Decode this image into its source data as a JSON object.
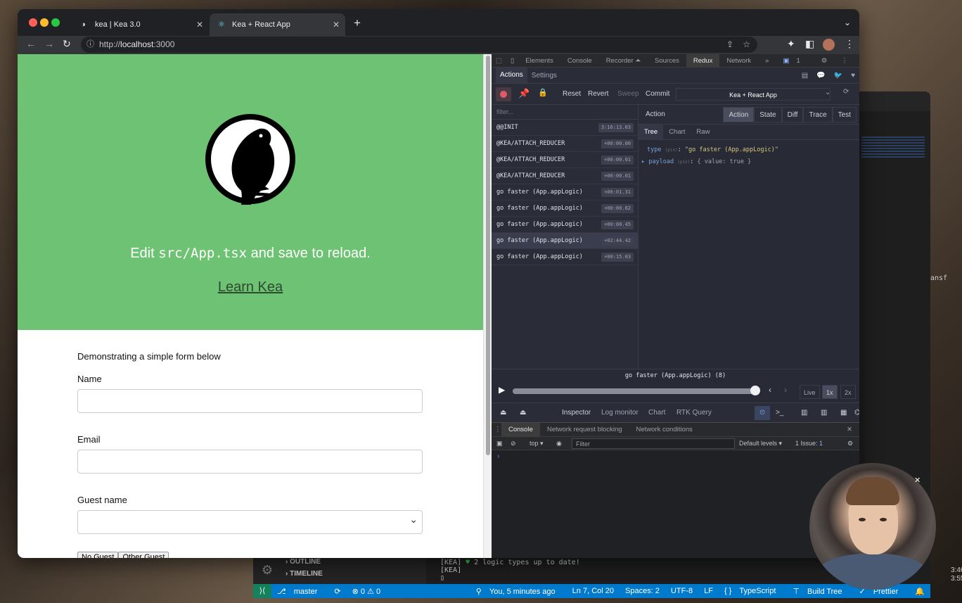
{
  "browser": {
    "tabs": [
      {
        "title": "kea | Kea 3.0",
        "active": false
      },
      {
        "title": "Kea + React App",
        "active": true
      }
    ],
    "url_scheme": "http://",
    "url_host": "localhost",
    "url_port": ":3000"
  },
  "page": {
    "edit_prefix": "Edit",
    "edit_code": "src/App.tsx",
    "edit_suffix": "and save to reload.",
    "learn_link": "Learn Kea",
    "form_intro": "Demonstrating a simple form below",
    "name_label": "Name",
    "email_label": "Email",
    "guest_label": "Guest name",
    "no_guest_button": "No Guest",
    "other_guest_button": "Other Guest"
  },
  "devtools": {
    "tabs": [
      "Elements",
      "Console",
      "Recorder ⏶",
      "Sources",
      "Redux",
      "Network",
      "»"
    ],
    "active_tab": "Redux",
    "issues_badge": "1",
    "redux": {
      "subtabs": [
        "Actions",
        "Settings"
      ],
      "buttons": {
        "reset": "Reset",
        "revert": "Revert",
        "sweep": "Sweep",
        "commit": "Commit"
      },
      "instance": "Kea + React App",
      "filter_placeholder": "filter...",
      "actions": [
        {
          "name": "@@INIT",
          "time": "3:16:13.03"
        },
        {
          "name": "@KEA/ATTACH_REDUCER",
          "time": "+00:00.00"
        },
        {
          "name": "@KEA/ATTACH_REDUCER",
          "time": "+00:00.01"
        },
        {
          "name": "@KEA/ATTACH_REDUCER",
          "time": "+00:00.01"
        },
        {
          "name": "go faster (App.appLogic)",
          "time": "+00:01.31"
        },
        {
          "name": "go faster (App.appLogic)",
          "time": "+00:00.62"
        },
        {
          "name": "go faster (App.appLogic)",
          "time": "+00:00.45"
        },
        {
          "name": "go faster (App.appLogic)",
          "time": "+02:44.42"
        },
        {
          "name": "go faster (App.appLogic)",
          "time": "+00:15.03"
        }
      ],
      "detail_title": "Action",
      "detail_tabs": [
        "Action",
        "State",
        "Diff",
        "Trace",
        "Test"
      ],
      "view_tabs": [
        "Tree",
        "Chart",
        "Raw"
      ],
      "tree": {
        "type_key": "type",
        "type_tag": "(pin)",
        "type_value": "\"go faster (App.appLogic)\"",
        "payload_key": "payload",
        "payload_tag": "(pin)",
        "payload_value": "{ value: true }"
      },
      "slider_label": "go faster (App.appLogic)  (8)",
      "slider_position": 1.0,
      "speed": [
        "Live",
        "1x",
        "2x"
      ],
      "monitors": [
        "Inspector",
        "Log monitor",
        "Chart",
        "RTK Query"
      ]
    },
    "drawer_tabs": [
      "Console",
      "Network request blocking",
      "Network conditions"
    ],
    "console": {
      "context": "top",
      "filter_placeholder": "Filter",
      "levels": "Default levels ▾",
      "issues": "1 Issue:",
      "issues_count": "1",
      "prompt": "›"
    }
  },
  "vscode": {
    "outline": "OUTLINE",
    "timeline": "TIMELINE",
    "terminal_line1_prefix": "[KEA]",
    "terminal_line1_heart": "♥",
    "terminal_line1_text": "2 logic types up to date!",
    "terminal_line2": "[KEA]",
    "right_text": "ansf",
    "status": {
      "branch": "master",
      "problems": "⊗ 0 ⚠ 0",
      "blame": "You, 5 minutes ago",
      "position": "Ln 7, Col 20",
      "spaces": "Spaces: 2",
      "encoding": "UTF-8",
      "eol": "LF",
      "language": "TypeScript",
      "build_tree": "Build Tree",
      "prettier": "Prettier"
    },
    "lines": [
      "3:46",
      "3:55"
    ]
  }
}
